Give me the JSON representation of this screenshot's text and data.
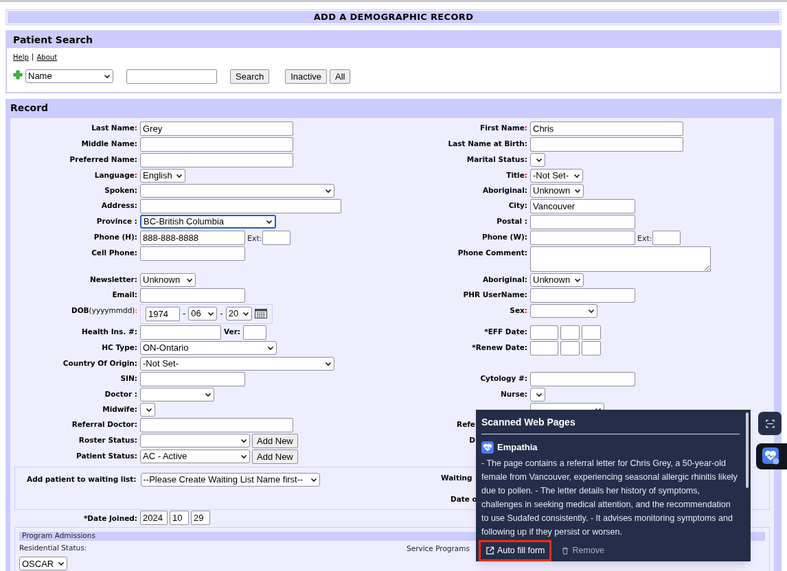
{
  "page_title": "ADD A DEMOGRAPHIC RECORD",
  "patient_search": {
    "title": "Patient Search",
    "links": [
      "Help",
      "About"
    ],
    "link_separator": "|",
    "search_by": "Name",
    "buttons": [
      "Search",
      "Inactive",
      "All"
    ]
  },
  "record": {
    "title": "Record",
    "rows": [
      {
        "left": {
          "label": "Last Name:",
          "required": true,
          "fields": [
            {
              "kind": "text",
              "value": "Grey"
            }
          ]
        },
        "right": {
          "label": "First Name:",
          "required": true,
          "fields": [
            {
              "kind": "text",
              "value": "Chris"
            }
          ]
        }
      },
      {
        "left": {
          "label": "Middle Name:",
          "required": false,
          "fields": [
            {
              "kind": "text"
            }
          ]
        },
        "right": {
          "label": "Last Name at Birth:",
          "required": false,
          "fields": [
            {
              "kind": "text"
            }
          ]
        }
      },
      {
        "left": {
          "label": "Preferred Name:",
          "required": false,
          "fields": [
            {
              "kind": "text"
            }
          ]
        },
        "right": {
          "label": "Marital Status:",
          "required": false,
          "fields": [
            {
              "kind": "select",
              "focused": false
            }
          ]
        }
      },
      {
        "left": {
          "label": "Language:",
          "required": true,
          "fields": [
            {
              "kind": "select",
              "value": "English",
              "focused": false
            }
          ]
        },
        "right": {
          "label": "Title:",
          "required": true,
          "fields": [
            {
              "kind": "select",
              "value": "-Not Set-",
              "focused": false
            }
          ]
        }
      },
      {
        "left": {
          "label": "Spoken:",
          "required": false,
          "fields": [
            {
              "kind": "select",
              "focused": false
            }
          ]
        },
        "right": {
          "label": "Aboriginal:",
          "required": false,
          "fields": [
            {
              "kind": "select",
              "value": "Unknown",
              "focused": false
            }
          ]
        }
      },
      {
        "left": {
          "label": "Address:",
          "required": false,
          "fields": [
            {
              "kind": "text"
            }
          ]
        },
        "right": {
          "label": "City:",
          "required": false,
          "fields": [
            {
              "kind": "text",
              "value": "Vancouver"
            }
          ]
        }
      },
      {
        "left": {
          "label": "Province :",
          "required": false,
          "fields": [
            {
              "kind": "select",
              "value": "BC-British Columbia",
              "focused": true
            }
          ]
        },
        "right": {
          "label": "Postal :",
          "required": false,
          "fields": [
            {
              "kind": "text"
            }
          ]
        }
      },
      {
        "left": {
          "label": "Phone (H):",
          "required": false,
          "fields": [
            {
              "kind": "text",
              "value": "888-888-8888"
            },
            {
              "kind": "caption",
              "text": "Ext:"
            },
            {
              "kind": "text"
            }
          ]
        },
        "right": {
          "label": "Phone (W):",
          "required": false,
          "fields": [
            {
              "kind": "text"
            },
            {
              "kind": "caption",
              "text": "Ext:"
            },
            {
              "kind": "text"
            }
          ]
        }
      },
      {
        "left": {
          "label": "Cell Phone:",
          "required": false,
          "fields": [
            {
              "kind": "text"
            }
          ]
        },
        "right": {
          "label": "Phone Comment:",
          "required": false,
          "fields": [
            {
              "kind": "textarea"
            }
          ]
        }
      },
      {
        "left": {
          "label": "Newsletter:",
          "required": false,
          "fields": [
            {
              "kind": "select",
              "value": "Unknown",
              "focused": false
            }
          ]
        },
        "right": {
          "label": "Aboriginal:",
          "required": false,
          "fields": [
            {
              "kind": "select",
              "value": "Unknown",
              "focused": false
            }
          ]
        }
      },
      {
        "left": {
          "label": "Email:",
          "required": false,
          "fields": [
            {
              "kind": "text"
            }
          ]
        },
        "right": {
          "label": "PHR UserName:",
          "required": false,
          "fields": [
            {
              "kind": "text"
            }
          ]
        }
      },
      {
        "left": {
          "label": "DOB",
          "hint": "(yyyymmdd):",
          "required": true,
          "framed": true,
          "fields": [
            {
              "kind": "text",
              "value": "1974"
            },
            {
              "kind": "separator",
              "text": "-"
            },
            {
              "kind": "select",
              "value": "06",
              "focused": false
            },
            {
              "kind": "separator",
              "text": "-"
            },
            {
              "kind": "select",
              "value": "20",
              "focused": false
            },
            {
              "kind": "calendar"
            }
          ]
        },
        "right": {
          "label": "Sex:",
          "required": true,
          "fields": [
            {
              "kind": "select",
              "focused": false
            }
          ]
        }
      },
      {
        "left": {
          "label": "Health Ins. #:",
          "required": false,
          "fields": [
            {
              "kind": "text"
            },
            {
              "kind": "label",
              "text": "Ver:"
            },
            {
              "kind": "text"
            }
          ]
        },
        "right": {
          "label": "*EFF Date:",
          "required": false,
          "fields": [
            {
              "kind": "text"
            },
            {
              "kind": "text"
            },
            {
              "kind": "text"
            }
          ]
        }
      },
      {
        "left": {
          "label": "HC Type:",
          "required": false,
          "fields": [
            {
              "kind": "select",
              "value": "ON-Ontario",
              "focused": false
            }
          ]
        },
        "right": {
          "label": "*Renew Date:",
          "required": false,
          "fields": [
            {
              "kind": "text"
            },
            {
              "kind": "text"
            },
            {
              "kind": "text"
            }
          ]
        }
      },
      {
        "left": {
          "label": "Country Of Origin:",
          "required": false,
          "fields": [
            {
              "kind": "select",
              "value": "-Not Set-",
              "focused": false
            }
          ]
        }
      },
      {
        "left": {
          "label": "SIN:",
          "required": false,
          "fields": [
            {
              "kind": "text"
            }
          ]
        },
        "right": {
          "label": "Cytology #:",
          "required": false,
          "fields": [
            {
              "kind": "text"
            }
          ]
        }
      },
      {
        "left": {
          "label": "Doctor :",
          "required": false,
          "fields": [
            {
              "kind": "select",
              "focused": false
            }
          ]
        },
        "right": {
          "label": "Nurse:",
          "required": false,
          "fields": [
            {
              "kind": "select",
              "focused": false
            }
          ]
        }
      },
      {
        "left": {
          "label": "Midwife:",
          "required": false,
          "fields": [
            {
              "kind": "select",
              "focused": false
            }
          ]
        },
        "right": {
          "fields": [
            {
              "kind": "select",
              "focused": false
            }
          ]
        }
      },
      {
        "left": {
          "label": "Referral Doctor:",
          "required": false,
          "fields": [
            {
              "kind": "text"
            }
          ]
        },
        "right": {
          "label": "Refe",
          "required": false,
          "cut": true
        }
      },
      {
        "left": {
          "label": "Roster Status:",
          "required": false,
          "fields": [
            {
              "kind": "select",
              "focused": false
            },
            {
              "kind": "button",
              "text": "Add New"
            }
          ]
        },
        "right": {
          "label": "D",
          "required": false,
          "cut": true
        }
      },
      {
        "left": {
          "label": "Patient Status:",
          "required": false,
          "fields": [
            {
              "kind": "select",
              "value": "AC - Active",
              "focused": false
            },
            {
              "kind": "button",
              "text": "Add New"
            }
          ]
        }
      }
    ],
    "waiting_list": {
      "label": "Add patient to waiting list:",
      "value": "--Please Create Waiting List Name first--",
      "right_labels": [
        "Waiting",
        "Date o"
      ]
    },
    "date_joined": {
      "label": "*Date Joined:",
      "values": [
        "2024",
        "10",
        "29"
      ]
    },
    "program_admissions": {
      "title": "Program Admissions",
      "residential_label": "Residential Status:",
      "required": true,
      "residential_value": "OSCAR",
      "service_programs": "Service Programs"
    }
  },
  "popup": {
    "title": "Scanned Web Pages",
    "source": "Empathia",
    "summary": "- The page contains a referral letter for Chris Grey, a 50-year-old female from Vancouver, experiencing seasonal allergic rhinitis likely due to pollen. - The letter details her history of symptoms, challenges in seeking medical attention, and the recommendation to use Sudafed consistently. - It advises monitoring symptoms and following up if they persist or worsen.",
    "actions": [
      {
        "kind": "autofill",
        "label": "Auto fill form",
        "highlighted": true
      },
      {
        "kind": "remove",
        "label": "Remove",
        "highlighted": false
      }
    ]
  },
  "side_buttons": [
    {
      "kind": "scan",
      "selected": false
    },
    {
      "kind": "app",
      "selected": true
    }
  ]
}
